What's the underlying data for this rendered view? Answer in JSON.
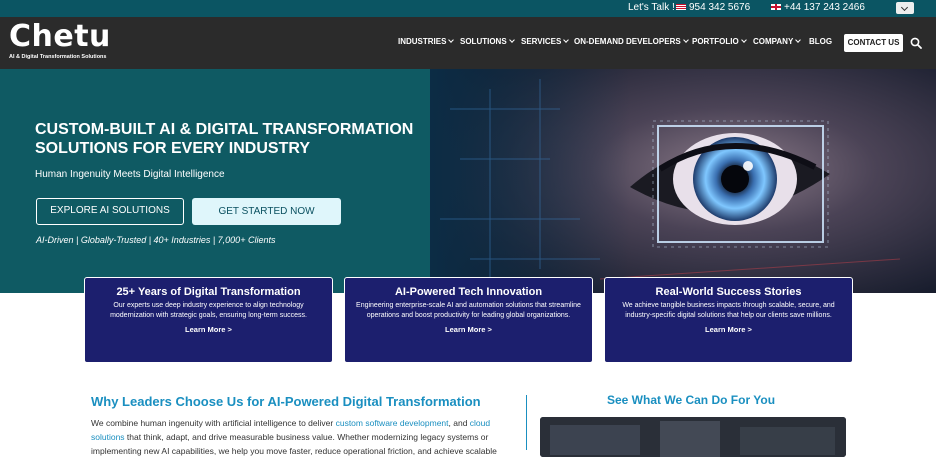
{
  "topbar": {
    "talk": "Let's Talk !",
    "phone_us": "954 342 5676",
    "phone_uk": "+44 137 243 2466",
    "flag_us_icon": "us-flag-icon",
    "flag_uk_icon": "uk-flag-icon",
    "dropdown_icon": "chevron-down-icon"
  },
  "logo": {
    "word": "Chetu",
    "tagline": "AI & Digital Transformation Solutions"
  },
  "nav": {
    "items": [
      {
        "label": "INDUSTRIES"
      },
      {
        "label": "SOLUTIONS"
      },
      {
        "label": "SERVICES"
      },
      {
        "label": "ON-DEMAND DEVELOPERS"
      },
      {
        "label": "PORTFOLIO"
      },
      {
        "label": "COMPANY"
      },
      {
        "label": "BLOG"
      }
    ],
    "contact": "CONTACT US",
    "search_icon": "search-icon"
  },
  "hero": {
    "title": "CUSTOM-BUILT AI & DIGITAL TRANSFORMATION SOLUTIONS FOR EVERY INDUSTRY",
    "subtitle": "Human Ingenuity Meets Digital Intelligence",
    "btn_explore": "EXPLORE AI SOLUTIONS",
    "btn_start": "GET STARTED NOW",
    "stats": "AI-Driven | Globally-Trusted | 40+ Industries | 7,000+ Clients"
  },
  "cards": [
    {
      "title": "25+ Years of Digital Transformation",
      "desc": "Our experts use deep industry experience to align technology modernization with strategic goals, ensuring long-term success.",
      "link": "Learn More >"
    },
    {
      "title": "AI-Powered Tech Innovation",
      "desc": "Engineering enterprise-scale AI and automation solutions that streamline operations and boost productivity for leading global organizations.",
      "link": "Learn More >"
    },
    {
      "title": "Real-World Success Stories",
      "desc": "We achieve tangible business impacts through scalable, secure, and industry-specific digital solutions that help our clients save millions.",
      "link": "Learn More >"
    }
  ],
  "why": {
    "title": "Why Leaders Choose Us for AI-Powered Digital Transformation",
    "p1": "We combine human ingenuity with artificial intelligence to deliver ",
    "link1": "custom software development",
    "p2": ", and ",
    "link2": "cloud solutions",
    "p3": " that think, adapt, and drive measurable business value. Whether modernizing legacy systems or implementing new AI capabilities, we help you move faster, reduce operational friction, and achieve scalable"
  },
  "see": {
    "title": "See What We Can Do For You"
  },
  "colors": {
    "topbar": "#0b5563",
    "nav": "#2b2b2b",
    "hero": "#0f5a63",
    "card": "#1c1f6e",
    "accent": "#1a8fc0"
  }
}
